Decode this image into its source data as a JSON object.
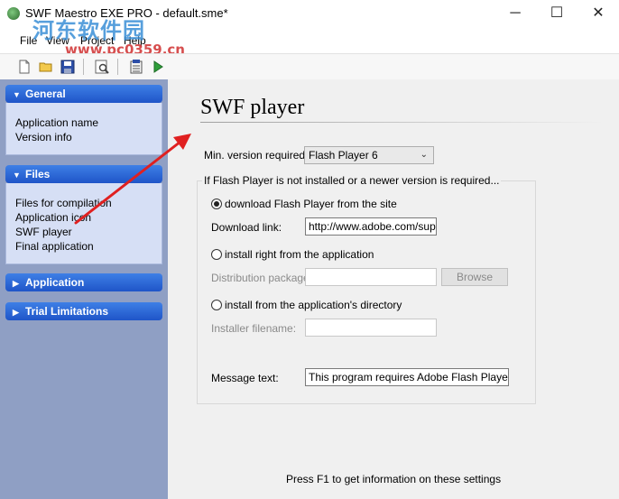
{
  "window": {
    "title": "SWF Maestro EXE PRO - default.sme*",
    "minimize": "─",
    "maximize": "☐",
    "close": "✕"
  },
  "watermark": {
    "cn_text": "河东软件园",
    "url": "www.pc0359.cn"
  },
  "menu": {
    "items": [
      "File",
      "View",
      "Project",
      "Help"
    ]
  },
  "toolbar": {
    "icons": [
      "new-file-icon",
      "open-folder-icon",
      "save-icon",
      "preview-icon",
      "compile-icon",
      "run-icon"
    ]
  },
  "sidebar": {
    "groups": [
      {
        "label": "General",
        "expanded": true,
        "items": [
          "Application name",
          "Version info"
        ]
      },
      {
        "label": "Files",
        "expanded": true,
        "items": [
          "Files for compilation",
          "Application icon",
          "SWF player",
          "Final application"
        ]
      },
      {
        "label": "Application",
        "expanded": false,
        "items": []
      },
      {
        "label": "Trial Limitations",
        "expanded": false,
        "items": []
      }
    ]
  },
  "main": {
    "title": "SWF player",
    "min_version_label": "Min. version required:",
    "min_version_value": "Flash Player 6",
    "group_title": "If Flash Player is not installed or a newer version is required...",
    "option_download": "download Flash Player from the site",
    "download_link_label": "Download link:",
    "download_link_value": "http://www.adobe.com/supp",
    "option_install_app": "install right from the application",
    "distribution_label": "Distribution package:",
    "distribution_value": "",
    "browse_label": "Browse",
    "option_install_dir": "install from the application's directory",
    "installer_label": "Installer filename:",
    "installer_value": "",
    "message_label": "Message text:",
    "message_value": "This program requires Adobe Flash Player Acti",
    "footer": "Press F1 to get information on these settings"
  },
  "colors": {
    "sidebar_bg": "#8f9fc4",
    "group_header": "#2d68d8",
    "group_body": "#d6dff5",
    "annotation_arrow": "#e02020"
  }
}
